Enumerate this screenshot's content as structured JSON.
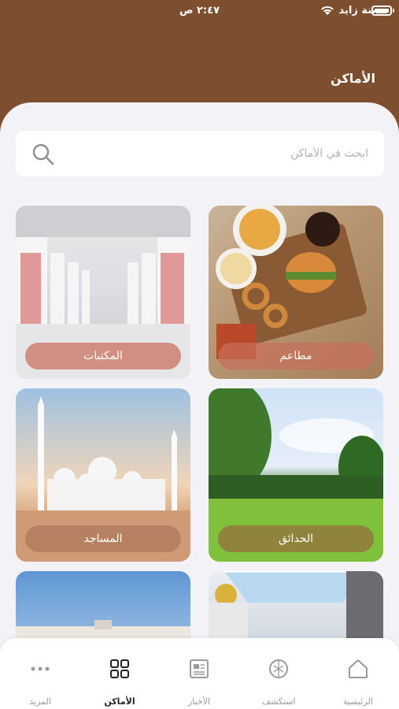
{
  "status_bar": {
    "time": "٢:٤٧ ص",
    "carrier": "مدينة زايد"
  },
  "header": {
    "title": "الأماكن"
  },
  "search": {
    "placeholder": "ابحث في الأماكن",
    "value": ""
  },
  "categories": [
    {
      "label": "مطاعم",
      "icon": "restaurant-image"
    },
    {
      "label": "المكتبات",
      "icon": "library-image"
    },
    {
      "label": "الحدائق",
      "icon": "park-image"
    },
    {
      "label": "المساجد",
      "icon": "mosque-image"
    },
    {
      "label": "",
      "icon": "mall-image"
    },
    {
      "label": "",
      "icon": "building-image"
    }
  ],
  "tabbar": {
    "items": [
      {
        "label": "الرئيسية",
        "icon": "home-icon"
      },
      {
        "label": "استكشف",
        "icon": "explore-icon"
      },
      {
        "label": "الأخبار",
        "icon": "news-icon"
      },
      {
        "label": "الأماكن",
        "icon": "grid-icon",
        "active": true
      },
      {
        "label": "المزيد",
        "icon": "more-icon"
      }
    ]
  },
  "colors": {
    "header_bg": "#7d4f2f",
    "sheet_bg": "#f2f2f7",
    "tab_inactive": "#9a9a9f",
    "tab_active": "#222222"
  }
}
